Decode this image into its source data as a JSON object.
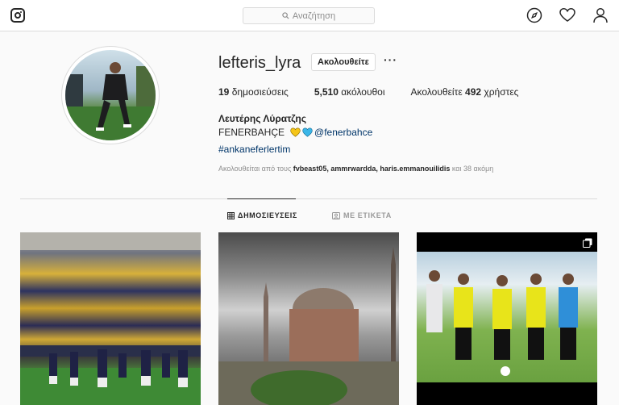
{
  "header": {
    "search_placeholder": "Αναζήτηση",
    "icons": [
      "instagram-logo",
      "compass-icon",
      "heart-icon",
      "user-icon"
    ]
  },
  "profile": {
    "username": "lefteris_lyra",
    "follow_label": "Ακολουθείτε",
    "more_label": "···",
    "stats": {
      "posts_count": "19",
      "posts_label": "δημοσιεύσεις",
      "followers_count": "5,510",
      "followers_label": "ακόλουθοι",
      "following_prefix": "Ακολουθείτε",
      "following_count": "492",
      "following_suffix": "χρήστες"
    },
    "full_name": "Λευτέρης Λύρατζης",
    "bio_text": "FENERBAHÇE",
    "bio_mention": "@fenerbahce",
    "hashtag": "#ankaneferlertim",
    "followed_by_prefix": "Ακολουθείται από τους",
    "followed_by_users": "fvbeast05, ammrwardda, haris.emmanouilidis",
    "followed_by_suffix": "και 38 ακόμη"
  },
  "tabs": [
    {
      "label": "ΔΗΜΟΣΙΕΥΣΕΙΣ",
      "active": true
    },
    {
      "label": "ΜΕ ΕΤΙΚΕΤΑ",
      "active": false
    }
  ],
  "colors": {
    "heart_yellow": "#f5c518",
    "heart_blue": "#3bb6e8",
    "link": "#003569"
  }
}
